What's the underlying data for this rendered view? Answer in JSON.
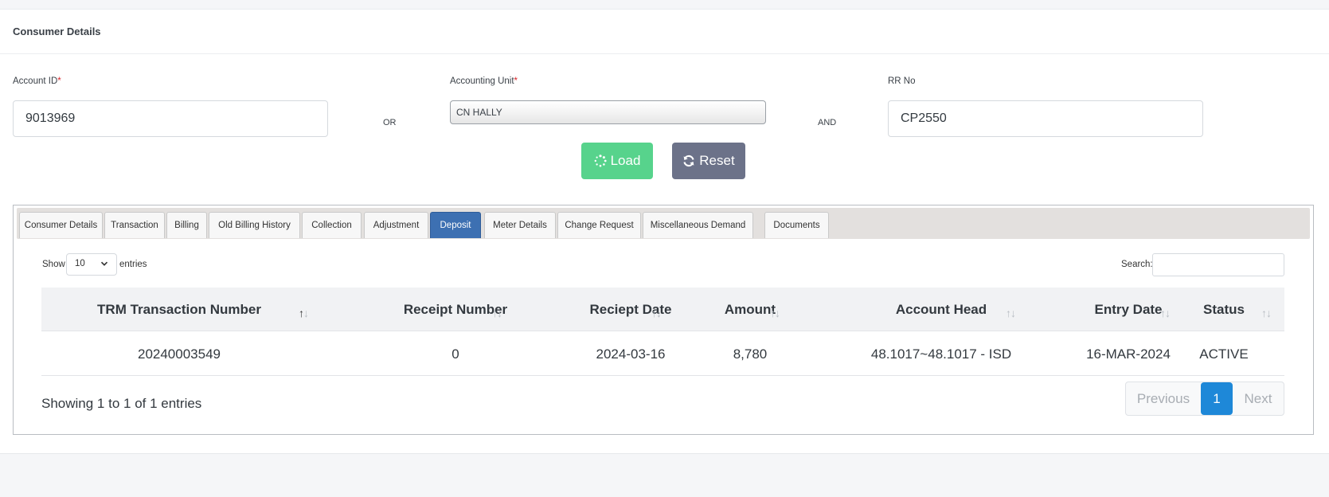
{
  "header": {
    "title": "Consumer Details"
  },
  "form": {
    "account_id": {
      "label": "Account ID",
      "required_mark": "*",
      "value": "9013969"
    },
    "or_label": "OR",
    "accounting_unit": {
      "label": "Accounting Unit",
      "required_mark": "*",
      "value": "CN HALLY"
    },
    "and_label": "AND",
    "rr_no": {
      "label": "RR No",
      "value": "CP2550"
    }
  },
  "actions": {
    "load_label": "Load",
    "reset_label": "Reset",
    "load_color": "#57d38c",
    "reset_color": "#6c7289"
  },
  "tabs": [
    {
      "label": "Consumer Details"
    },
    {
      "label": "Transaction"
    },
    {
      "label": "Billing"
    },
    {
      "label": "Old Billing History"
    },
    {
      "label": "Collection"
    },
    {
      "label": "Adjustment"
    },
    {
      "label": "Deposit",
      "active": true
    },
    {
      "label": "Meter Details"
    },
    {
      "label": "Change Request"
    },
    {
      "label": "Miscellaneous Demand"
    },
    {
      "label": "Documents"
    }
  ],
  "table": {
    "show_label": "Show",
    "entries_label": "entries",
    "page_length": "10",
    "search_label": "Search:",
    "search_value": "",
    "columns": [
      "TRM Transaction Number",
      "Receipt Number",
      "Reciept Date",
      "Amount",
      "Account Head",
      "Entry Date",
      "Status"
    ],
    "rows": [
      [
        "20240003549",
        "0",
        "2024-03-16",
        "8,780",
        "48.1017~48.1017 - ISD",
        "16-MAR-2024",
        "ACTIVE"
      ]
    ],
    "info": "Showing 1 to 1 of 1 entries",
    "pagination": {
      "previous": "Previous",
      "current": "1",
      "next": "Next"
    }
  },
  "colors": {
    "active_tab": "#3d70b2",
    "current_page": "#1e88d8",
    "required": "#d9262b"
  }
}
